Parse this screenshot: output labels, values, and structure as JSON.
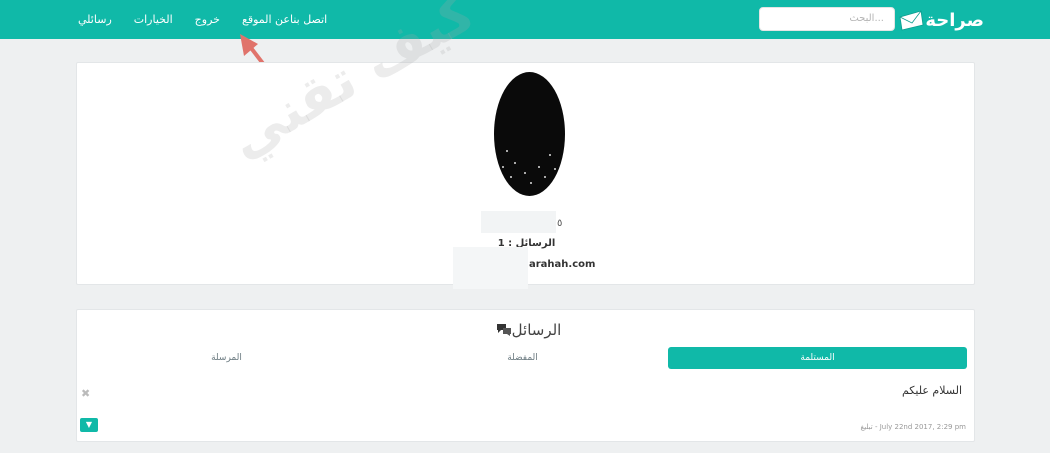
{
  "nav": {
    "logo_text": "صراحة",
    "search_placeholder": "البحث...",
    "links": [
      "رسائلي",
      "الخيارات",
      "خروج",
      "عن الموقع",
      "اتصل بنا"
    ]
  },
  "profile": {
    "name_tail": "٥",
    "message_count": "الرسائل : 1",
    "url": "arahah.com"
  },
  "watermark": "كيف تقني",
  "messages": {
    "title": "الرسائل",
    "chat_icon": "chat-bubbles-icon",
    "tabs": [
      "المستلمة",
      "المفضلة",
      "المرسلة"
    ],
    "close_symbol": "✖",
    "message_text": "السلام عليكم",
    "date": "July 22nd 2017, 2:29 pm - تبليغ",
    "dropdown_symbol": "▼"
  },
  "colors": {
    "brand": "#10b9a8",
    "arrow": "#e0736b"
  }
}
